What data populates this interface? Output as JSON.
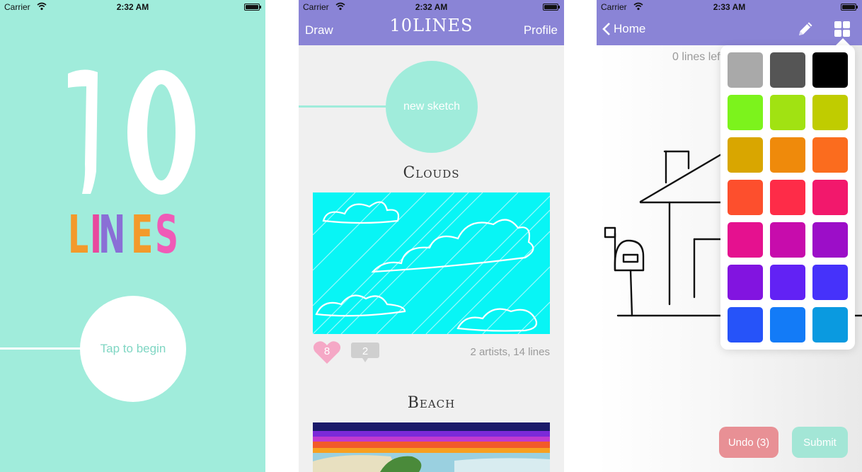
{
  "status_bars": [
    {
      "carrier": "Carrier",
      "time": "2:32 AM"
    },
    {
      "carrier": "Carrier",
      "time": "2:32 AM"
    },
    {
      "carrier": "Carrier",
      "time": "2:33 AM"
    }
  ],
  "splash": {
    "logo_number": "10",
    "logo_word": [
      "L",
      "I",
      "N",
      "E",
      "S"
    ],
    "logo_word_colors": [
      "#f39a2b",
      "#e8489e",
      "#8a6fd6",
      "#f39a2b",
      "#f05bb7"
    ],
    "tap_to_begin": "Tap to begin"
  },
  "feed": {
    "nav_left": "Draw",
    "nav_title": "10LINES",
    "nav_right": "Profile",
    "new_sketch": "new sketch",
    "cards": [
      {
        "title": "Clouds",
        "likes": "8",
        "comments": "2",
        "meta": "2 artists, 14 lines"
      },
      {
        "title": "Beach"
      }
    ]
  },
  "draw": {
    "back_label": "Home",
    "lines_left": "0 lines left",
    "undo_label": "Undo (3)",
    "submit_label": "Submit",
    "icons": [
      "chevron-left-icon",
      "pencil-icon",
      "grid-icon"
    ],
    "palette": [
      "#a9a9a9",
      "#555555",
      "#000000",
      "#7cf31c",
      "#a1e212",
      "#c0cc00",
      "#d9a600",
      "#ef8a0b",
      "#fb6c1e",
      "#fd4f2d",
      "#fe2c48",
      "#f2186c",
      "#e5118f",
      "#c70cac",
      "#9c0ec8",
      "#8214e0",
      "#6222f4",
      "#4632fa",
      "#2653f9",
      "#137bf7",
      "#0a9ae0"
    ]
  },
  "colors": {
    "mint": "#a0ecdb",
    "nav_purple": "#8a84d6",
    "heart_pink": "#f5a8c6",
    "comment_gray": "#cfcfcf",
    "undo_red": "#e89095",
    "submit_mint": "#a3e6d6"
  }
}
